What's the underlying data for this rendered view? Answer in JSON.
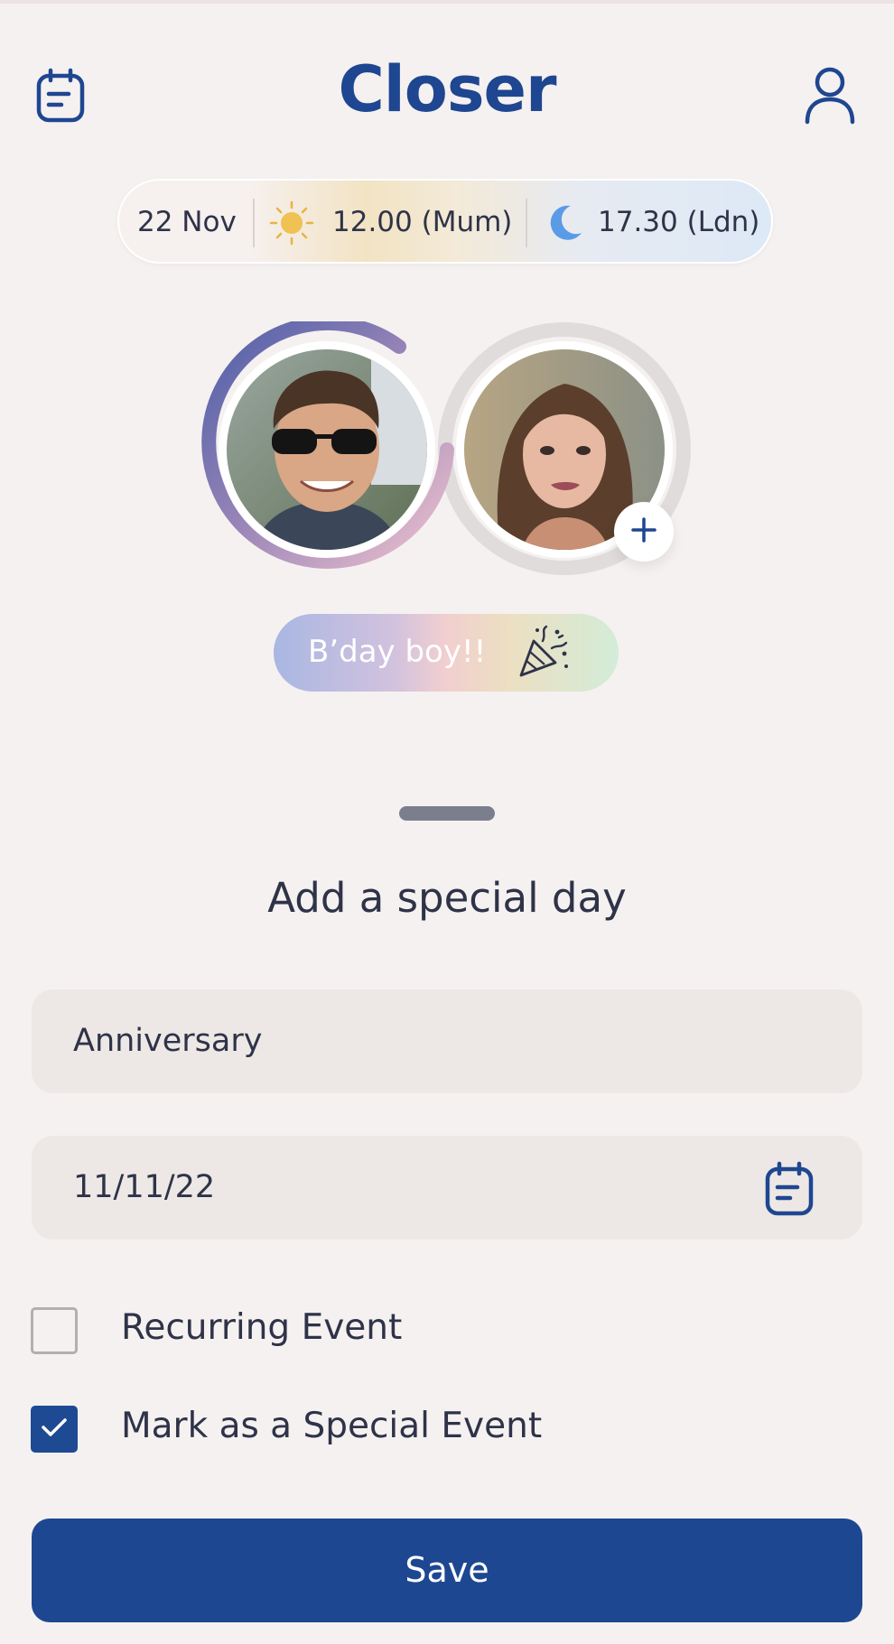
{
  "app": {
    "title": "Closer"
  },
  "header": {
    "calendar_icon": "calendar-icon",
    "profile_icon": "user-icon"
  },
  "time_bar": {
    "date": "22 Nov",
    "day_time": "12.00 (Mum)",
    "night_time": "17.30 (Ldn)",
    "day_icon": "sun-icon",
    "night_icon": "moon-icon"
  },
  "status_badge": {
    "label": "B’day boy!!",
    "icon": "party-popper-icon"
  },
  "sheet": {
    "title": "Add a special day",
    "event_name_value": "Anniversary",
    "date_value": "11/11/22",
    "recurring_label": "Recurring Event",
    "recurring_checked": false,
    "special_label": "Mark as a Special Event",
    "special_checked": true,
    "save_label": "Save"
  },
  "colors": {
    "brand": "#1f4690",
    "background": "#f5f1f1",
    "field_bg": "#ede8e6",
    "button": "#1e4792"
  }
}
